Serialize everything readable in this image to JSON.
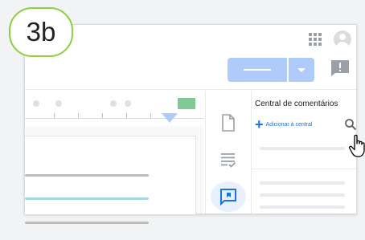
{
  "step_badge": "3b",
  "comments_panel": {
    "title": "Central de comentários",
    "add_label": "Adicionar à central"
  },
  "icons": {
    "apps": "apps-grid-icon",
    "account": "account-avatar-icon",
    "feedback": "feedback-icon",
    "document": "document-icon",
    "checklist": "checklist-icon",
    "comments": "comment-bubble-icon",
    "search": "search-icon",
    "cursor": "hand-cursor-icon"
  },
  "colors": {
    "accent": "#1a73e8",
    "share_button": "#aecbfa",
    "badge_border": "#8fce3d",
    "ruler_marker": "#81c995",
    "highlighted_line": "#a5d8e3"
  }
}
